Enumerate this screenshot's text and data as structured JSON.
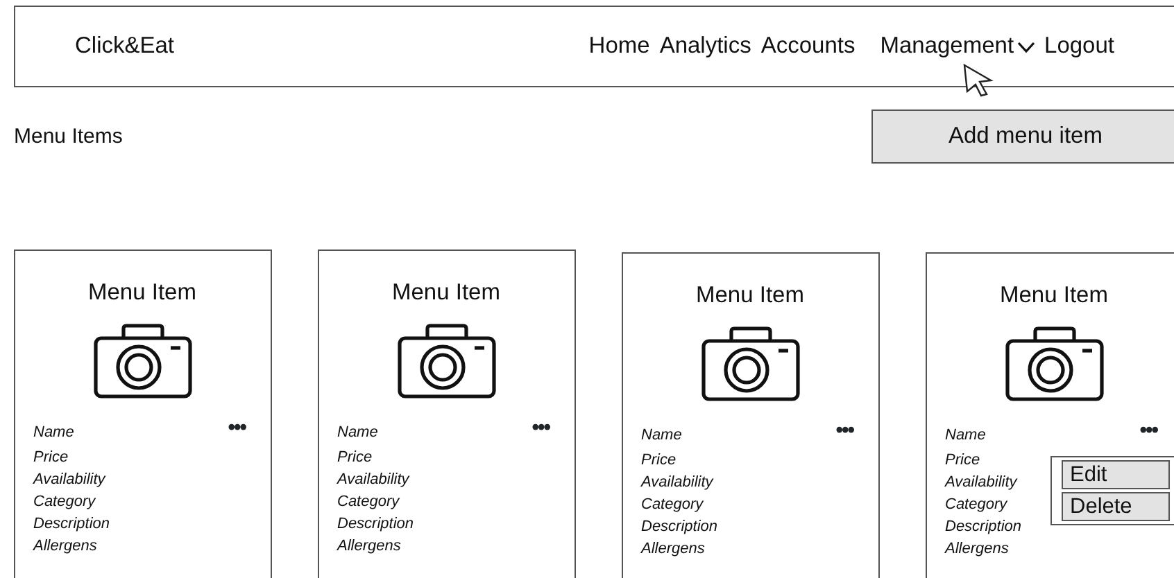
{
  "header": {
    "brand": "Click&Eat",
    "nav": [
      {
        "label": "Home",
        "dropdown": false,
        "hovered": false
      },
      {
        "label": "Analytics",
        "dropdown": false,
        "hovered": false
      },
      {
        "label": "Accounts",
        "dropdown": false,
        "hovered": false
      },
      {
        "label": "Management",
        "dropdown": true,
        "hovered": true
      },
      {
        "label": "Logout",
        "dropdown": false,
        "hovered": false
      }
    ]
  },
  "page_title": "Menu Items",
  "add_button": "Add menu item",
  "cards": [
    {
      "title": "Menu Item",
      "fields": [
        "Name",
        "Price",
        "Availability",
        "Category",
        "Description",
        "Allergens"
      ],
      "more": "•••"
    },
    {
      "title": "Menu Item",
      "fields": [
        "Name",
        "Price",
        "Availability",
        "Category",
        "Description",
        "Allergens"
      ],
      "more": "•••"
    },
    {
      "title": "Menu Item",
      "fields": [
        "Name",
        "Price",
        "Availability",
        "Category",
        "Description",
        "Allergens"
      ],
      "more": "•••"
    },
    {
      "title": "Menu Item",
      "fields": [
        "Name",
        "Price",
        "Availability",
        "Category",
        "Description",
        "Allergens"
      ],
      "more": "•••",
      "menu": [
        "Edit",
        "Delete"
      ]
    }
  ]
}
